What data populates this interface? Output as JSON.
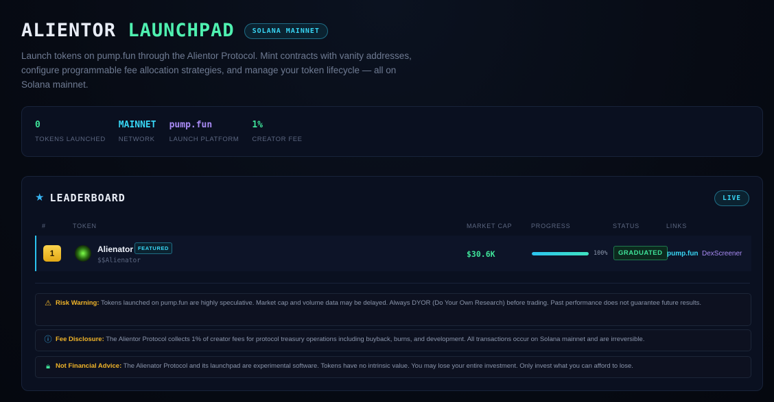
{
  "header": {
    "title_part1": "ALIENTOR",
    "title_part2": "LAUNCHPAD",
    "network_badge": "SOLANA MAINNET",
    "description": "Launch tokens on pump.fun through the Alientor Protocol. Mint contracts with vanity addresses, configure programmable fee allocation strategies, and manage your token lifecycle — all on Solana mainnet."
  },
  "stats": [
    {
      "value": "0",
      "label": "TOKENS LAUNCHED",
      "color": "#3fe39a"
    },
    {
      "value": "MAINNET",
      "label": "NETWORK",
      "color": "#38d6f5"
    },
    {
      "value": "pump.fun",
      "label": "LAUNCH PLATFORM",
      "color": "#a98bf5"
    },
    {
      "value": "1%",
      "label": "CREATOR FEE",
      "color": "#3fe39a"
    }
  ],
  "leaderboard": {
    "title": "LEADERBOARD",
    "live_badge": "LIVE",
    "columns": {
      "rank": "#",
      "token": "TOKEN",
      "market_cap": "MARKET CAP",
      "progress": "PROGRESS",
      "status": "STATUS",
      "links": "LINKS"
    },
    "rows": [
      {
        "rank": "1",
        "name": "Alienator",
        "badge": "FEATURED",
        "symbol": "$$Alienator",
        "market_cap": "$30.6K",
        "progress_percent": 100,
        "progress_label": "100%",
        "status": "GRADUATED",
        "link1": "pump.fun",
        "link2": "DexScreener"
      }
    ]
  },
  "notices": [
    {
      "icon": "warning-icon",
      "title": "Risk Warning:",
      "text": " Tokens launched on pump.fun are highly speculative. Market cap and volume data may be delayed. Always DYOR (Do Your Own Research) before trading. Past performance does not guarantee future results."
    },
    {
      "icon": "info-icon",
      "title": "Fee Disclosure:",
      "text": " The Alientor Protocol collects 1% of creator fees for protocol treasury operations including buyback, burns, and development. All transactions occur on Solana mainnet and are irreversible."
    },
    {
      "icon": "lock-icon",
      "title": "Not Financial Advice:",
      "text": " The Alienator Protocol and its launchpad are experimental software. Tokens have no intrinsic value. You may lose your entire investment. Only invest what you can afford to lose."
    }
  ]
}
